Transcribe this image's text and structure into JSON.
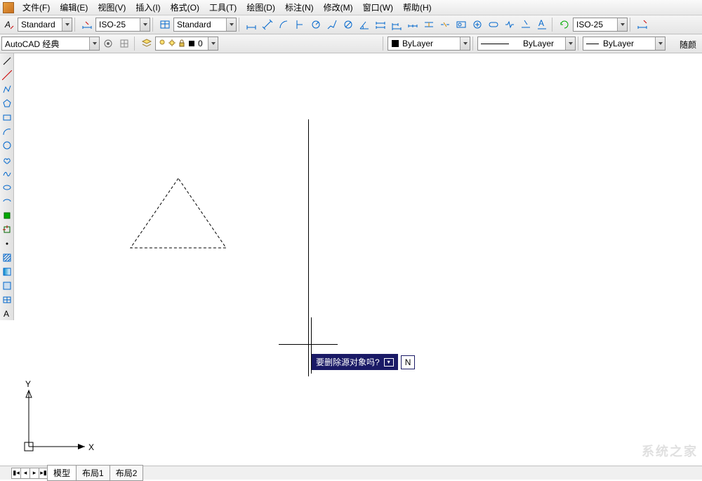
{
  "menu": {
    "file": "文件(F)",
    "edit": "编辑(E)",
    "view": "视图(V)",
    "insert": "插入(I)",
    "format": "格式(O)",
    "tools": "工具(T)",
    "draw": "绘图(D)",
    "dimension": "标注(N)",
    "modify": "修改(M)",
    "window": "窗口(W)",
    "help": "帮助(H)"
  },
  "toolbar1": {
    "style1": "Standard",
    "style2": "ISO-25",
    "style3": "Standard",
    "style4": "ISO-25"
  },
  "toolbar2": {
    "workspace": "AutoCAD 经典",
    "layer_value": "0",
    "color_label": "ByLayer",
    "linetype_label": "ByLayer",
    "lineweight_label": "ByLayer",
    "extra_button": "随颜"
  },
  "canvas": {
    "y_axis_label": "Y",
    "x_axis_label": "X",
    "tooltip_prompt": "要删除源对象吗?",
    "tooltip_value": "N"
  },
  "tabs": {
    "model": "模型",
    "layout1": "布局1",
    "layout2": "布局2"
  },
  "watermark": "系统之家",
  "icons": {
    "text_style": "text-style-icon",
    "dim_style": "dim-style-icon",
    "table_style": "table-style-icon",
    "gear": "gear-icon",
    "bulb": "lightbulb-icon",
    "sun": "sun-icon",
    "lock": "lock-icon"
  }
}
